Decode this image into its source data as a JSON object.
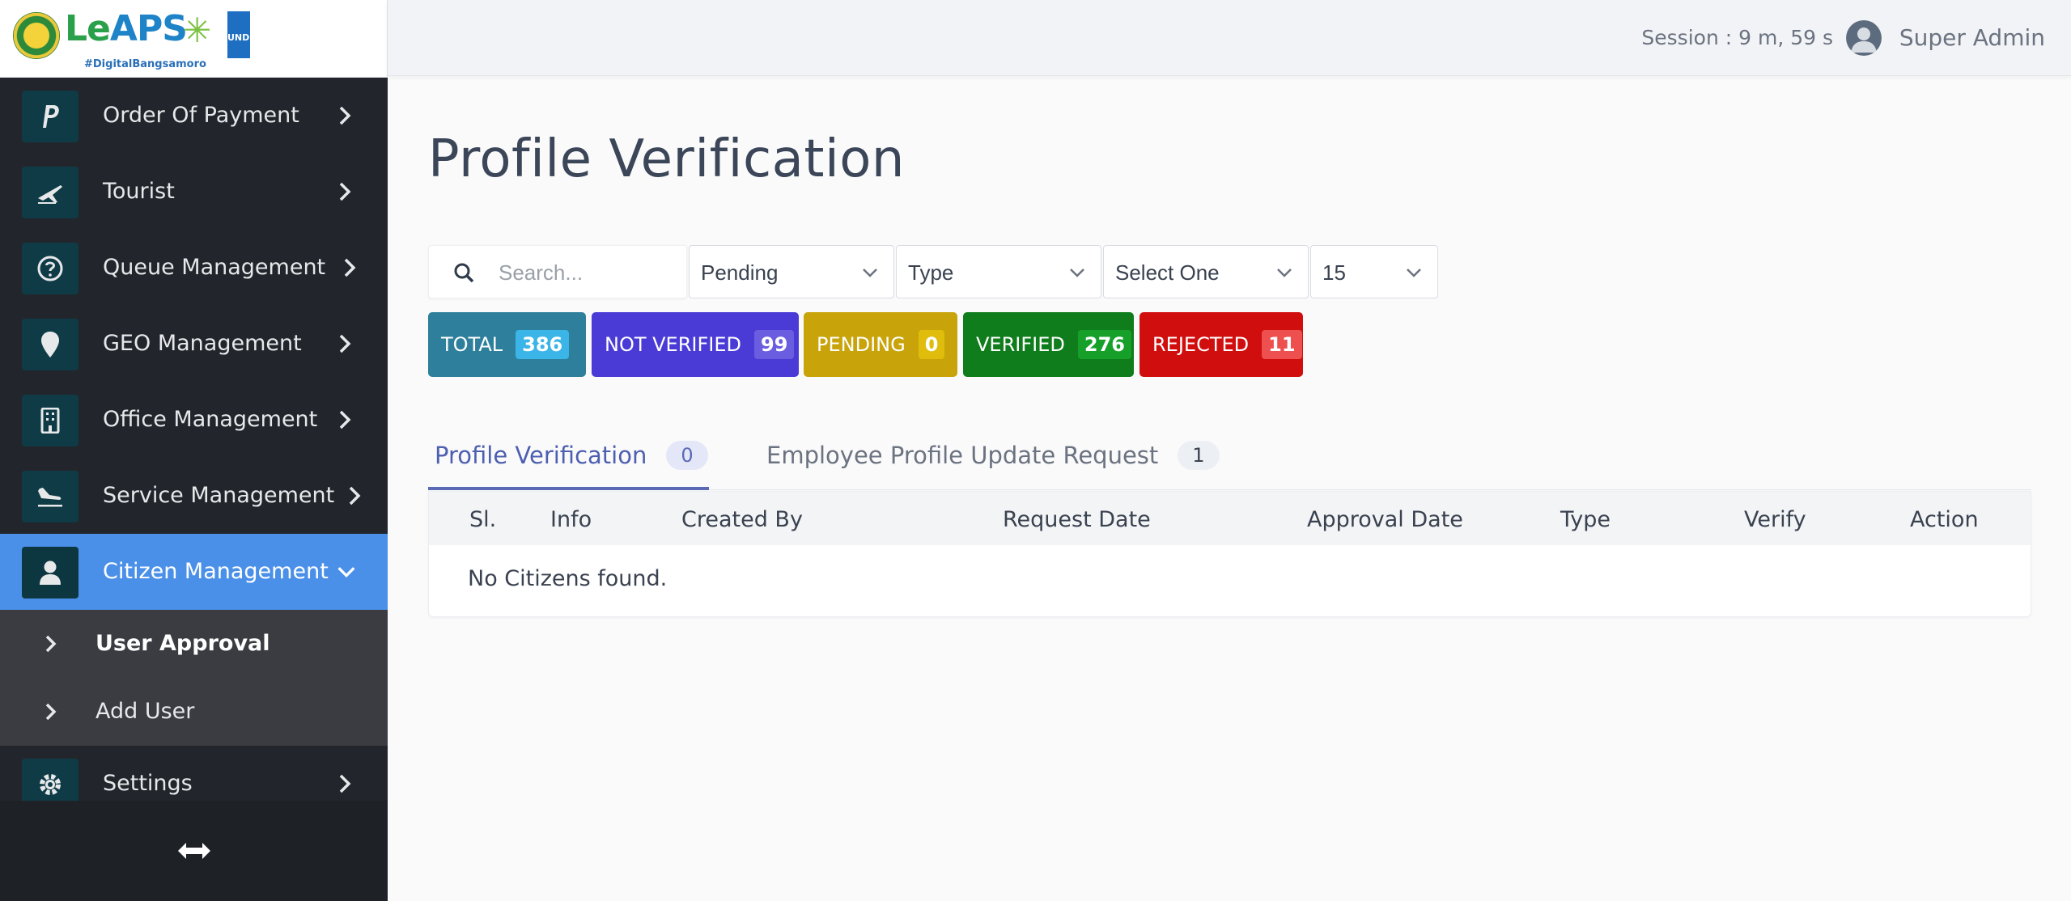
{
  "brand": {
    "logo_text": "LeAPS",
    "hashtag": "#DigitalBangsamoro",
    "partner": "UNDP"
  },
  "sidebar": {
    "items": [
      {
        "label": "Order Of Payment",
        "icon": "paypal-icon"
      },
      {
        "label": "Tourist",
        "icon": "airplane-icon"
      },
      {
        "label": "Queue Management",
        "icon": "question-circle-icon"
      },
      {
        "label": "GEO Management",
        "icon": "map-pin-icon"
      },
      {
        "label": "Office Management",
        "icon": "building-icon"
      },
      {
        "label": "Service Management",
        "icon": "plane-landing-icon"
      },
      {
        "label": "Citizen Management",
        "icon": "user-icon",
        "active": true
      },
      {
        "label": "Settings",
        "icon": "gear-icon"
      }
    ],
    "submenu": [
      {
        "label": "User Approval",
        "current": true
      },
      {
        "label": "Add User"
      }
    ]
  },
  "header": {
    "session": "Session : 9 m, 59 s",
    "user_name": "Super Admin"
  },
  "main": {
    "title": "Profile Verification",
    "search_placeholder": "Search...",
    "filters": {
      "status": "Pending",
      "type": "Type",
      "select_one": "Select One",
      "page_size": "15"
    },
    "badges": [
      {
        "label": "TOTAL",
        "count": "386",
        "bg": "#2e7f9c",
        "count_bg": "#3bb4e8"
      },
      {
        "label": "NOT VERIFIED",
        "count": "99",
        "bg": "#4a3bd6",
        "count_bg": "#6a5de0"
      },
      {
        "label": "PENDING",
        "count": "0",
        "bg": "#c8a30a",
        "count_bg": "#e0bc0c"
      },
      {
        "label": "VERIFIED",
        "count": "276",
        "bg": "#0f7d1c",
        "count_bg": "#16a02a"
      },
      {
        "label": "REJECTED",
        "count": "11",
        "bg": "#d10e0e",
        "count_bg": "#ee4f4f"
      }
    ],
    "tabs": [
      {
        "label": "Profile Verification",
        "count": "0"
      },
      {
        "label": "Employee Profile Update Request",
        "count": "1"
      }
    ],
    "table": {
      "columns": [
        "Sl.",
        "Info",
        "Created By",
        "Request Date",
        "Approval Date",
        "Type",
        "Verify",
        "Action"
      ],
      "empty_message": "No Citizens found."
    }
  }
}
